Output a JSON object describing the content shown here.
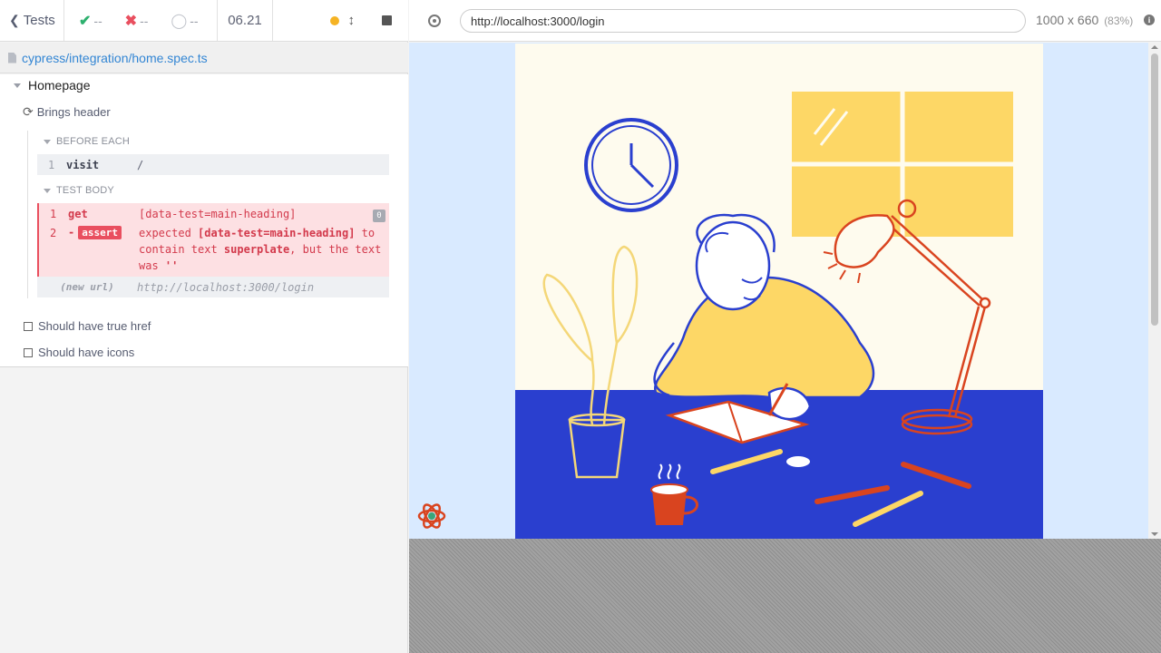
{
  "toolbar": {
    "tests_label": "Tests",
    "passed": "--",
    "failed": "--",
    "pending": "--",
    "duration": "06.21"
  },
  "spec": {
    "path": "cypress/integration/home.spec.ts"
  },
  "suite": {
    "title": "Homepage",
    "test_title": "Brings header",
    "before_each": {
      "title": "BEFORE EACH",
      "commands": [
        {
          "num": "1",
          "name": "visit",
          "message": "/"
        }
      ]
    },
    "test_body": {
      "title": "TEST BODY",
      "commands": [
        {
          "num": "1",
          "name": "get",
          "message": "[data-test=main-heading]",
          "badge": "0"
        },
        {
          "num": "2",
          "prefix": "-",
          "name": "assert",
          "message_parts": [
            "expected ",
            "[data-test=main-heading]",
            " to contain text ",
            "superplate",
            ", but the text was ",
            "''"
          ]
        }
      ],
      "new_url": {
        "name": "(new url)",
        "message": "http://localhost:3000/login"
      }
    },
    "pending_tests": [
      "Should have true href",
      "Should have icons"
    ]
  },
  "aut": {
    "url": "http://localhost:3000/login",
    "viewport": "1000 x 660",
    "scale": "(83%)"
  },
  "colors": {
    "pass": "#2db06e",
    "fail": "#e94f5f",
    "link": "#3386d4",
    "aut_bg": "#d9eaff",
    "illustration_desk": "#2a3fcf",
    "illustration_yellow": "#fdd766"
  },
  "icons": [
    "chevron-left-icon",
    "check-icon",
    "x-icon",
    "spinner-icon",
    "running-dot-icon",
    "resize-arrows-icon",
    "stop-icon",
    "file-icon",
    "refresh-icon",
    "checkbox-icon",
    "target-icon",
    "info-icon",
    "react-logo-icon"
  ]
}
